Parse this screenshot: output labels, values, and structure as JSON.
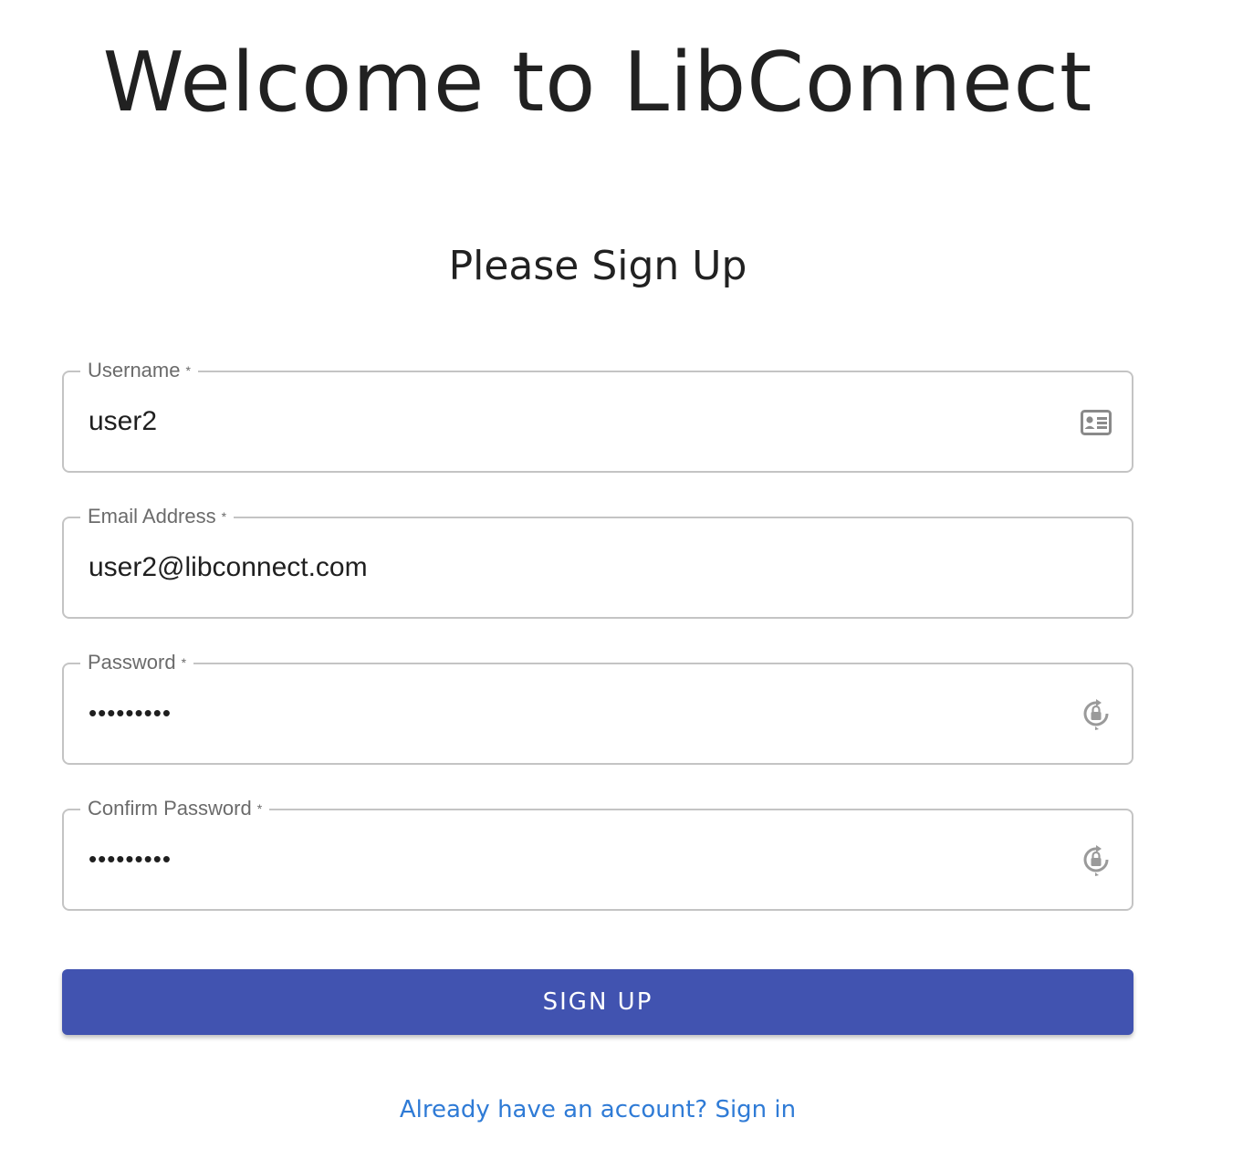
{
  "header": {
    "title": "Welcome to LibConnect"
  },
  "form": {
    "title": "Please Sign Up",
    "fields": [
      {
        "label": "Username",
        "required_mark": "*",
        "value": "user2",
        "icon": "contact-card-icon"
      },
      {
        "label": "Email Address",
        "required_mark": "*",
        "value": "user2@libconnect.com",
        "icon": ""
      },
      {
        "label": "Password",
        "required_mark": "*",
        "value": "•••••••••",
        "icon": "lock-reset-icon"
      },
      {
        "label": "Confirm Password",
        "required_mark": "*",
        "value": "•••••••••",
        "icon": "lock-reset-icon"
      }
    ],
    "submit_label": "SIGN UP",
    "signin_link": "Already have an account? Sign in"
  },
  "colors": {
    "primary": "#4153b0",
    "link": "#2f7bd6",
    "border": "#c4c4c4",
    "label": "#6b6b6b"
  }
}
